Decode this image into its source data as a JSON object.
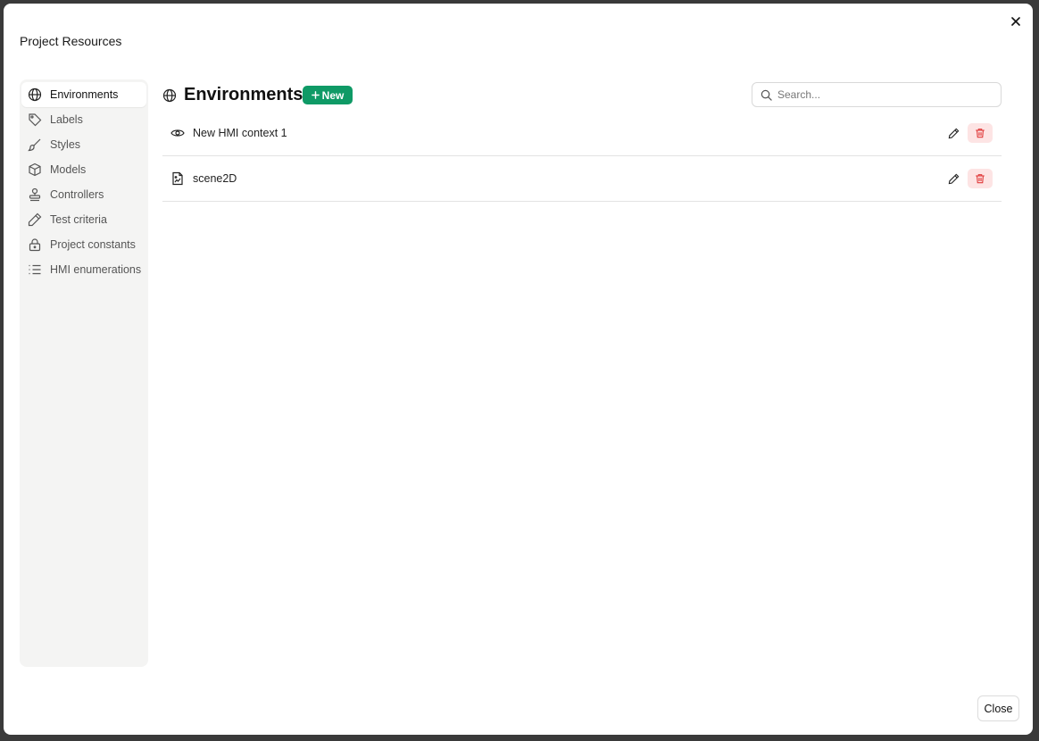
{
  "dialog": {
    "title": "Project Resources",
    "close_button": "Close"
  },
  "sidebar": {
    "items": [
      {
        "label": "Environments",
        "icon": "globe-icon",
        "active": true
      },
      {
        "label": "Labels",
        "icon": "tag-icon"
      },
      {
        "label": "Styles",
        "icon": "brush-icon"
      },
      {
        "label": "Models",
        "icon": "box-icon"
      },
      {
        "label": "Controllers",
        "icon": "stamp-icon"
      },
      {
        "label": "Test criteria",
        "icon": "ruler-pen-icon"
      },
      {
        "label": "Project constants",
        "icon": "lock-icon"
      },
      {
        "label": "HMI enumerations",
        "icon": "list-icon"
      }
    ]
  },
  "main": {
    "title": "Environments",
    "new_button": "New",
    "search": {
      "placeholder": "Search...",
      "value": ""
    },
    "rows": [
      {
        "name": "New HMI context 1",
        "icon": "eye-icon"
      },
      {
        "name": "scene2D",
        "icon": "image-file-icon"
      }
    ]
  },
  "colors": {
    "accent": "#0f9a66",
    "danger_bg": "#fde4e4",
    "danger": "#e03b3b"
  }
}
